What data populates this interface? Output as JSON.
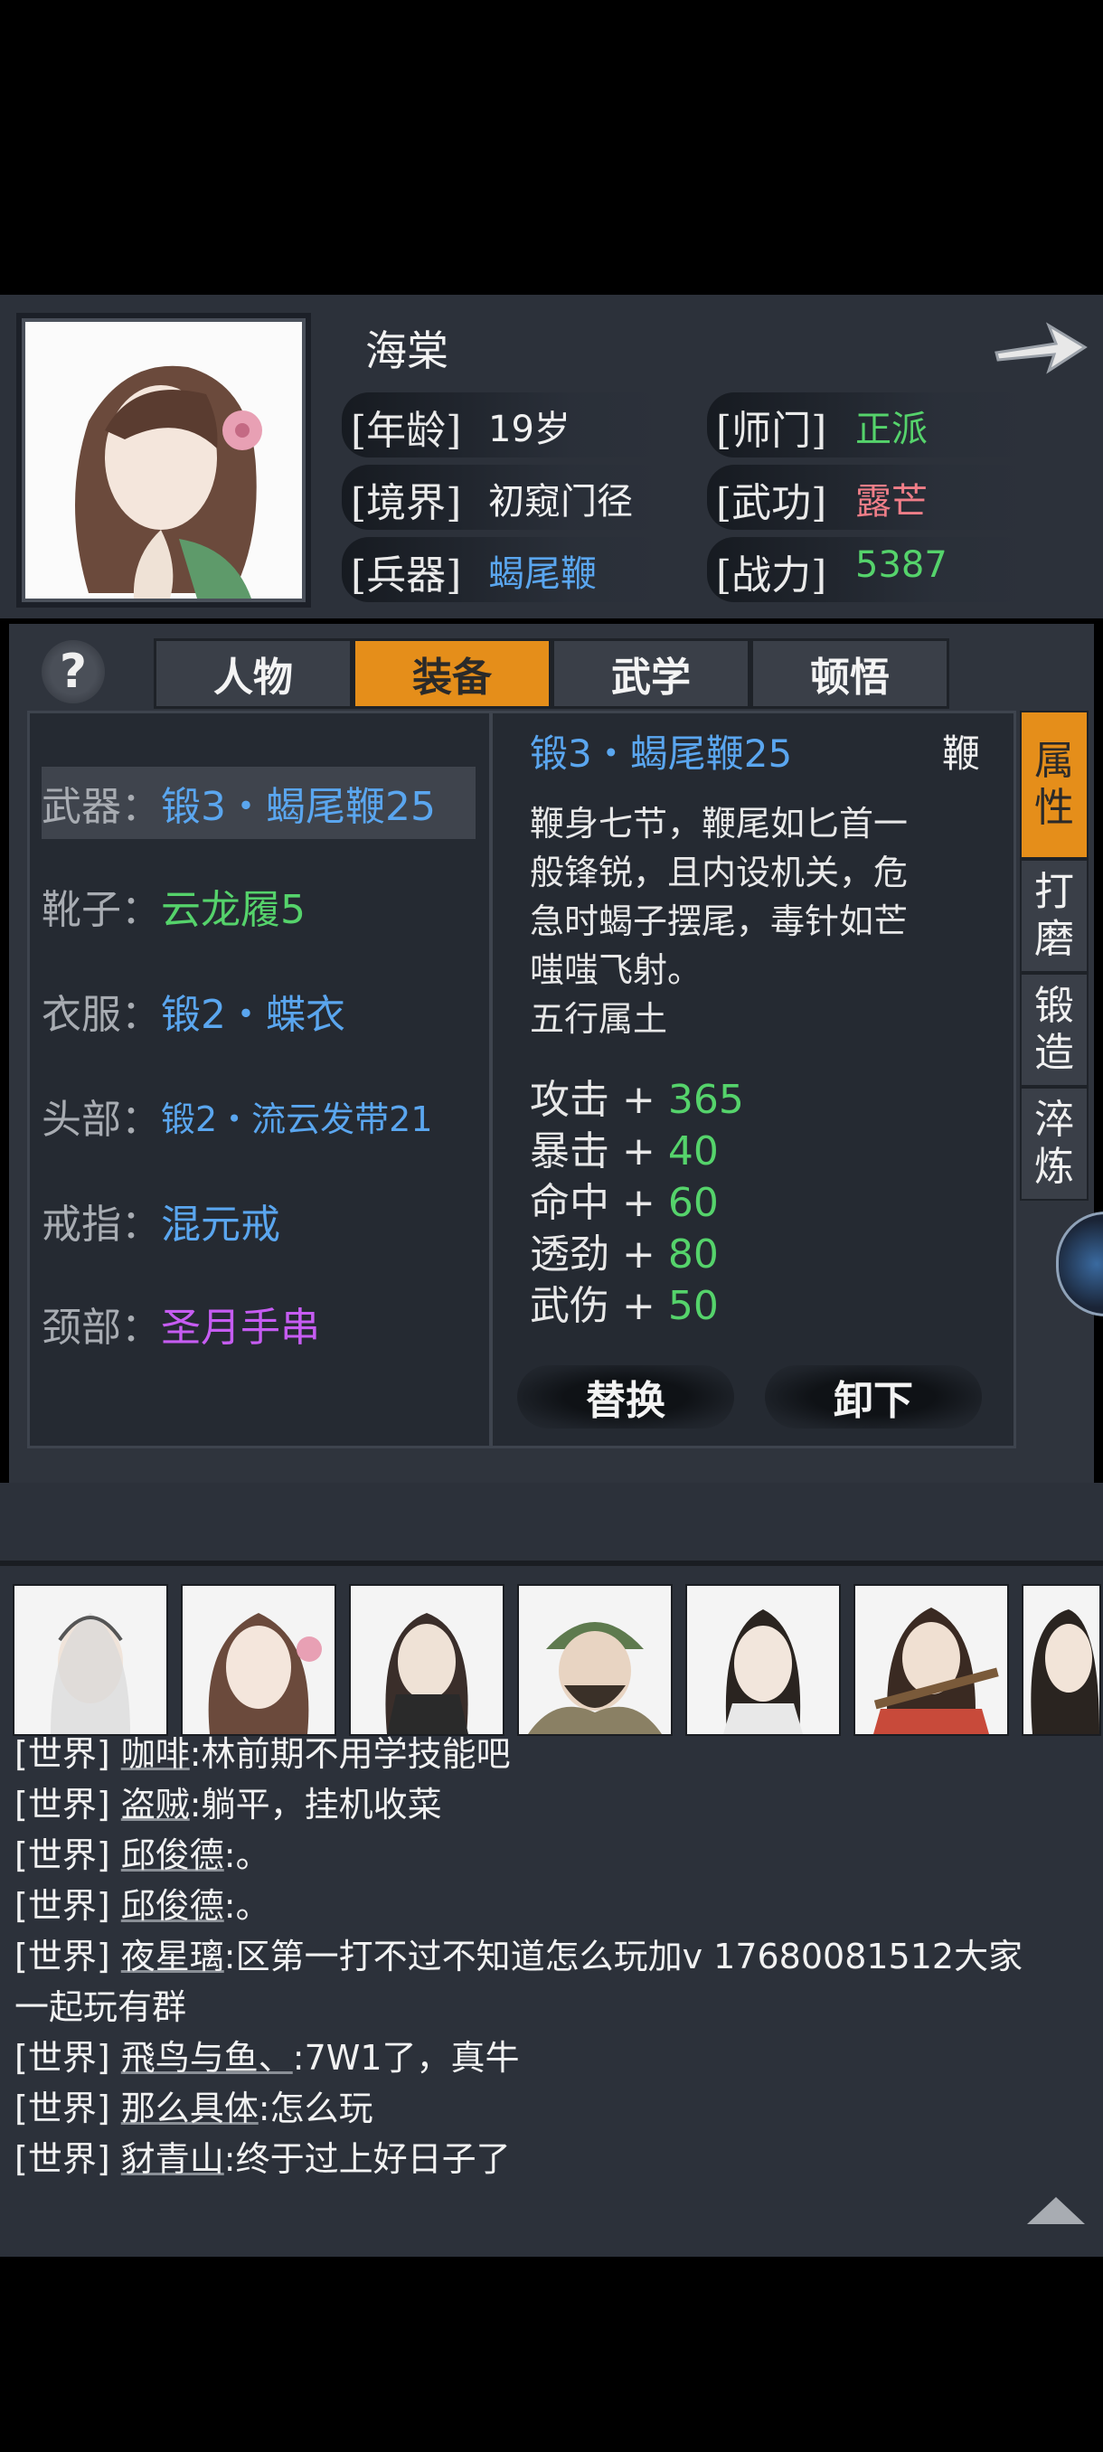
{
  "character": {
    "name": "海棠",
    "age_label": "[年龄]",
    "age_value": "19岁",
    "sect_label": "[师门]",
    "sect_value": "正派",
    "realm_label": "[境界]",
    "realm_value": "初窥门径",
    "martial_label": "[武功]",
    "martial_value": "露芒",
    "weapon_label": "[兵器]",
    "weapon_value": "蝎尾鞭",
    "power_label": "[战力]",
    "power_value": "5387"
  },
  "tabs": [
    {
      "label": "人物"
    },
    {
      "label": "装备"
    },
    {
      "label": "武学"
    },
    {
      "label": "顿悟"
    }
  ],
  "active_tab": "装备",
  "help_symbol": "?",
  "equipment": [
    {
      "slot": "武器：",
      "item": "锻3・蝎尾鞭25",
      "color": "#5aa6ef"
    },
    {
      "slot": "靴子：",
      "item": "云龙履5",
      "color": "#55d36b"
    },
    {
      "slot": "衣服：",
      "item": "锻2・蝶衣",
      "color": "#5aa6ef"
    },
    {
      "slot": "头部：",
      "item": "锻2・流云发带21",
      "color": "#5aa6ef"
    },
    {
      "slot": "戒指：",
      "item": "混元戒",
      "color": "#5aa6ef"
    },
    {
      "slot": "颈部：",
      "item": "圣月手串",
      "color": "#c65cf2"
    }
  ],
  "detail": {
    "title": "锻3・蝎尾鞭25",
    "type": "鞭",
    "desc_lines": [
      "鞭身七节，鞭尾如匕首一",
      "般锋锐，且内设机关，危",
      "急时蝎子摆尾，毒针如芒",
      "嗤嗤飞射。"
    ],
    "element": "五行属土",
    "stats": [
      {
        "name": "攻击",
        "plus": "+",
        "value": "365"
      },
      {
        "name": "暴击",
        "plus": "+",
        "value": "40"
      },
      {
        "name": "命中",
        "plus": "+",
        "value": "60"
      },
      {
        "name": "透劲",
        "plus": "+",
        "value": "80"
      },
      {
        "name": "武伤",
        "plus": "+",
        "value": "50"
      }
    ],
    "replace_label": "替换",
    "unequip_label": "卸下"
  },
  "side_tabs": [
    {
      "chars": [
        "属",
        "性"
      ]
    },
    {
      "chars": [
        "打",
        "磨"
      ]
    },
    {
      "chars": [
        "锻",
        "造"
      ]
    },
    {
      "chars": [
        "淬",
        "炼"
      ]
    }
  ],
  "chat": [
    {
      "channel": "[世界]",
      "name": "咖啡",
      "text": ":林前期不用学技能吧"
    },
    {
      "channel": "[世界]",
      "name": "盗贼",
      "text": ":躺平，挂机收菜"
    },
    {
      "channel": "[世界]",
      "name": "邱俊德",
      "text": ":。"
    },
    {
      "channel": "[世界]",
      "name": "邱俊德",
      "text": ":。"
    },
    {
      "channel": "[世界]",
      "name": "夜星璃",
      "text": ":区第一打不过不知道怎么玩加v 17680081512大家"
    },
    {
      "channel": "",
      "name": "",
      "text": "一起玩有群"
    },
    {
      "channel": "[世界]",
      "name": "飛鸟与鱼、",
      "text": ":7W1了，真牛"
    },
    {
      "channel": "[世界]",
      "name": "那么具体",
      "text": ":怎么玩"
    },
    {
      "channel": "[世界]",
      "name": "豺青山",
      "text": ":终于过上好日子了"
    }
  ]
}
